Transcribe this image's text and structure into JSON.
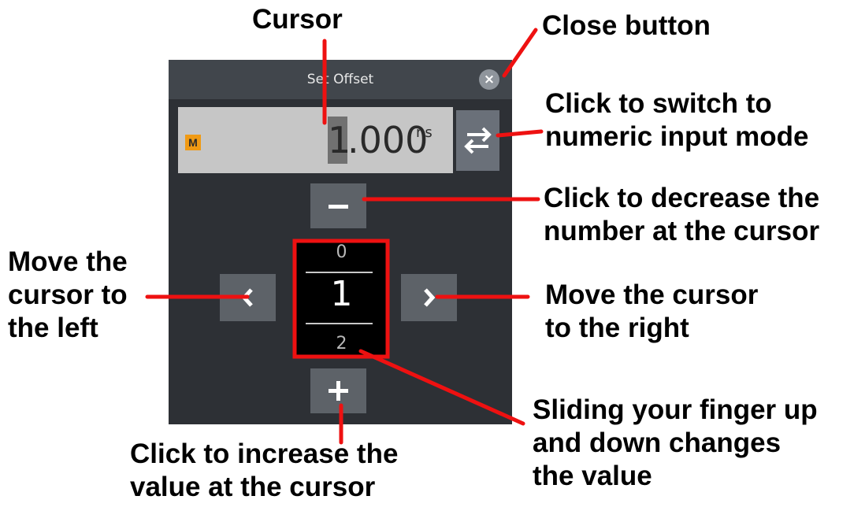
{
  "dialog": {
    "title": "Set Offset",
    "close_symbol": "×",
    "mode_badge": "M",
    "value_cursor_digit": "1",
    "value_rest": ".000",
    "value_unit": "ns",
    "swap_icon": "swap-arrows-icon",
    "minus_label": "−",
    "plus_label": "+",
    "left_label": "‹",
    "right_label": "›",
    "wheel": {
      "previous": "0",
      "current": "1",
      "next": "2"
    }
  },
  "annotations": {
    "cursor": "Cursor",
    "close_button": "Close button",
    "switch_mode": [
      "Click to switch to",
      "numeric input mode"
    ],
    "decrease": [
      "Click to decrease the",
      "number at the cursor"
    ],
    "move_left": [
      "Move the",
      "cursor to",
      "the left"
    ],
    "move_right": [
      "Move the cursor",
      "to the right"
    ],
    "increase": [
      "Click to increase the",
      "value at the cursor"
    ],
    "slide": [
      "Sliding your finger up",
      "and down changes",
      "the value"
    ]
  },
  "colors": {
    "annotation_red": "#ee1111",
    "wheel_outline_red": "#ee1111",
    "dialog_bg": "#2d3035",
    "mode_badge": "#f09a14"
  }
}
